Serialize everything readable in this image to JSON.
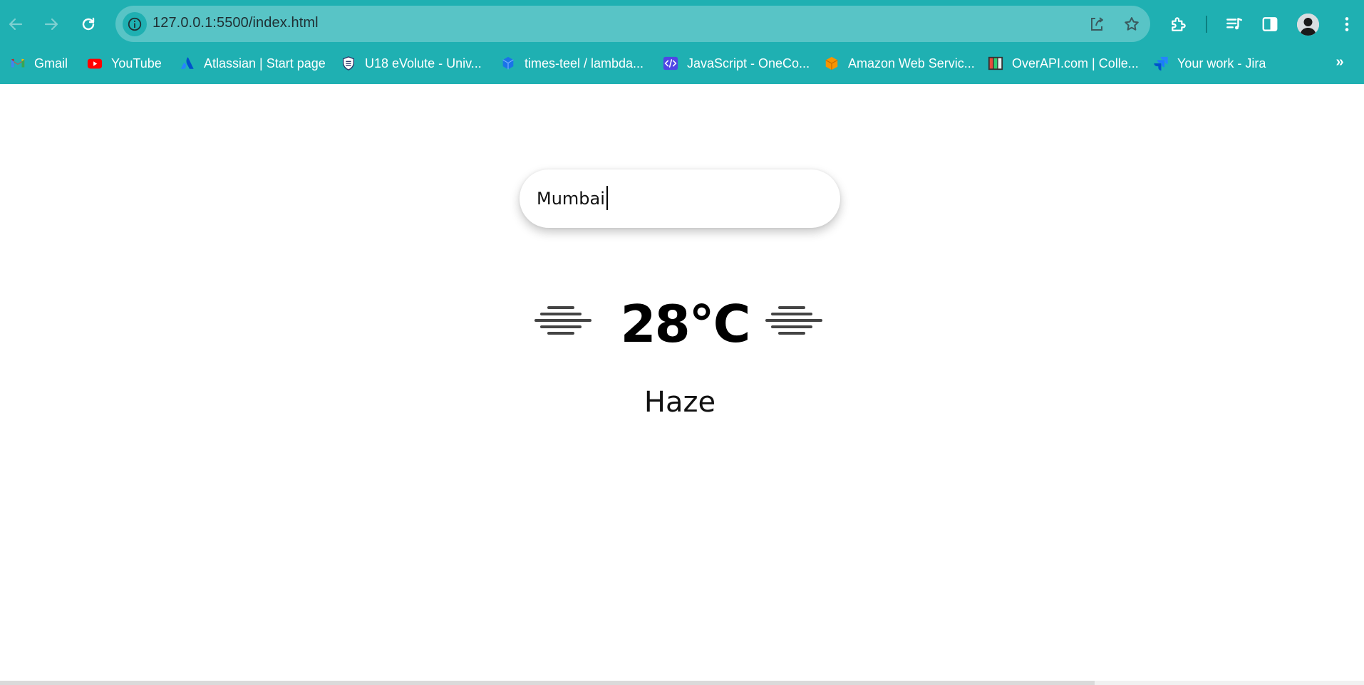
{
  "browser": {
    "url": "127.0.0.1:5500/index.html",
    "theme_color": "#1fb0b2",
    "omnibox_color": "#58c4c6",
    "icons": {
      "back": "arrow-left-icon",
      "forward": "arrow-right-icon",
      "reload": "reload-icon",
      "site_info": "info-icon",
      "share": "share-icon",
      "bookmark": "star-icon",
      "extensions": "puzzle-icon",
      "media": "media-queue-icon",
      "side_panel": "side-panel-icon",
      "profile": "avatar",
      "menu": "kebab-menu-icon"
    }
  },
  "bookmarks": [
    {
      "label": "Gmail",
      "icon": "gmail-icon"
    },
    {
      "label": "YouTube",
      "icon": "youtube-icon"
    },
    {
      "label": "Atlassian | Start page",
      "icon": "atlassian-icon"
    },
    {
      "label": "U18 eVolute - Univ...",
      "icon": "university-crest-icon"
    },
    {
      "label": "times-teel / lambda...",
      "icon": "cube-icon"
    },
    {
      "label": "JavaScript - OneCo...",
      "icon": "code-icon"
    },
    {
      "label": "Amazon Web Servic...",
      "icon": "aws-box-icon"
    },
    {
      "label": "OverAPI.com | Colle...",
      "icon": "overapi-icon"
    },
    {
      "label": "Your work - Jira",
      "icon": "jira-icon"
    }
  ],
  "bookmarks_more": "»",
  "weather": {
    "search_value": "Mumbai",
    "temperature": "28°C",
    "condition": "Haze",
    "icon": "haze-icon"
  }
}
